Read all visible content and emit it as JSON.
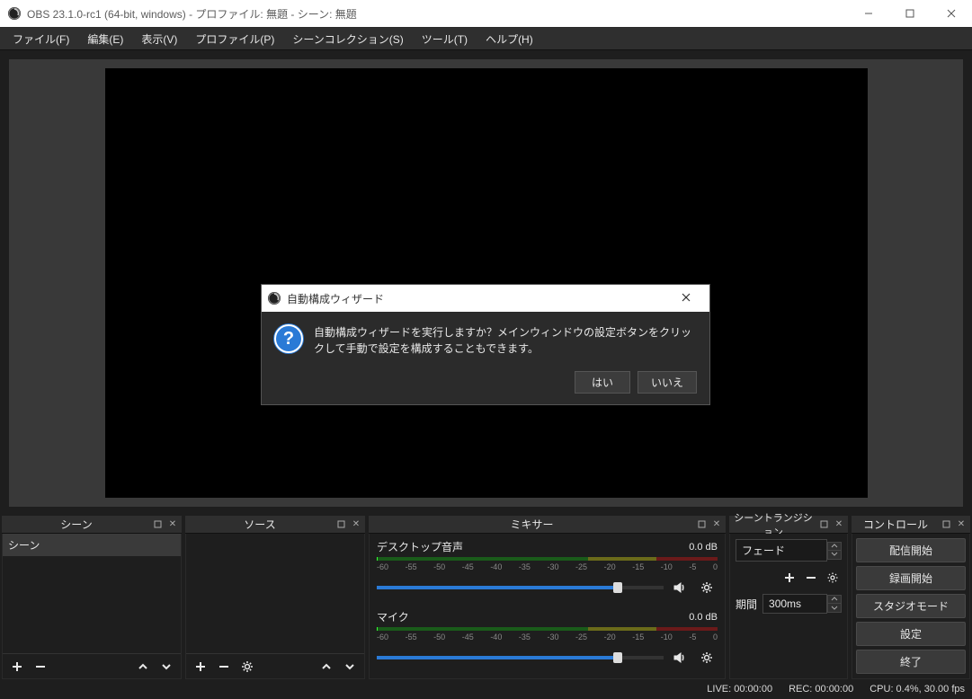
{
  "window": {
    "title": "OBS 23.1.0-rc1 (64-bit, windows) - プロファイル: 無題 - シーン: 無題"
  },
  "menu": [
    "ファイル(F)",
    "編集(E)",
    "表示(V)",
    "プロファイル(P)",
    "シーンコレクション(S)",
    "ツール(T)",
    "ヘルプ(H)"
  ],
  "dialog": {
    "title": "自動構成ウィザード",
    "message": "自動構成ウィザードを実行しますか？メインウィンドウの設定ボタンをクリックして手動で設定を構成することもできます。",
    "yes": "はい",
    "no": "いいえ"
  },
  "docks": {
    "scenes": {
      "title": "シーン",
      "item": "シーン"
    },
    "sources": {
      "title": "ソース"
    },
    "mixer": {
      "title": "ミキサー",
      "tracks": [
        {
          "name": "デスクトップ音声",
          "db": "0.0 dB"
        },
        {
          "name": "マイク",
          "db": "0.0 dB"
        }
      ],
      "ticks": [
        "-60",
        "-55",
        "-50",
        "-45",
        "-40",
        "-35",
        "-30",
        "-25",
        "-20",
        "-15",
        "-10",
        "-5",
        "0"
      ]
    },
    "transitions": {
      "title": "シーントランジション",
      "value": "フェード",
      "duration_label": "期間",
      "duration": "300ms"
    },
    "controls": {
      "title": "コントロール",
      "buttons": [
        "配信開始",
        "録画開始",
        "スタジオモード",
        "設定",
        "終了"
      ]
    }
  },
  "status": {
    "live": "LIVE: 00:00:00",
    "rec": "REC: 00:00:00",
    "cpu": "CPU: 0.4%, 30.00 fps"
  }
}
